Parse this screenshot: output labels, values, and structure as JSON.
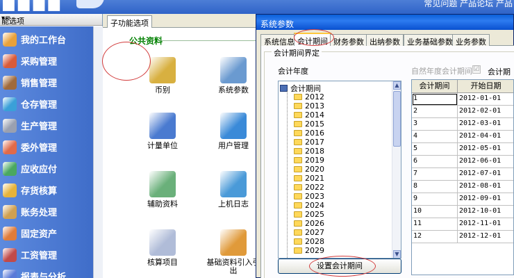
{
  "banner": {
    "logo": "■■■■",
    "links": "常见问题  产品论坛  产品"
  },
  "sidebar": {
    "header": "能选项",
    "pin": "▾≡",
    "items": [
      {
        "label": "我的工作台",
        "color": "#e8a13a"
      },
      {
        "label": "采购管理",
        "color": "#d85b3a"
      },
      {
        "label": "销售管理",
        "color": "#a06a3c"
      },
      {
        "label": "仓存管理",
        "color": "#3aa0d8"
      },
      {
        "label": "生产管理",
        "color": "#9aa0b0"
      },
      {
        "label": "委外管理",
        "color": "#e06a4a"
      },
      {
        "label": "应收应付",
        "color": "#4aa860"
      },
      {
        "label": "存货核算",
        "color": "#e8b33a"
      },
      {
        "label": "账务处理",
        "color": "#d0a050"
      },
      {
        "label": "固定资产",
        "color": "#e07c3a"
      },
      {
        "label": "工资管理",
        "color": "#c04a4a"
      },
      {
        "label": "报表与分析",
        "color": "#5a7ad8"
      }
    ]
  },
  "middle": {
    "tab": "子功能选项",
    "section_title": "公共资料",
    "functions": [
      {
        "label": "币别",
        "color": "#d8b040"
      },
      {
        "label": "系统参数",
        "color": "#6a9ad0"
      },
      {
        "label": "计量单位",
        "color": "#4a7ad0"
      },
      {
        "label": "用户管理",
        "color": "#3a8ad8"
      },
      {
        "label": "辅助资料",
        "color": "#6ab07a"
      },
      {
        "label": "上机日志",
        "color": "#4a9ad8"
      },
      {
        "label": "核算项目",
        "color": "#b0bcd8"
      },
      {
        "label": "基础资料引入引出",
        "color": "#e09a3a"
      }
    ]
  },
  "dialog": {
    "title": "系统参数",
    "tabs": [
      "系统信息",
      "会计期间",
      "财务参数",
      "出纳参数",
      "业务基础参数",
      "业务参数"
    ],
    "group_title": "会计期间界定",
    "year_label": "会计年度",
    "natural_year_label": "自然年度会计期间",
    "checkbox_mark": "☑",
    "period_label": "会计期",
    "tree_root": "会计期间",
    "years": [
      "2012",
      "2013",
      "2014",
      "2015",
      "2016",
      "2017",
      "2018",
      "2019",
      "2020",
      "2021",
      "2022",
      "2023",
      "2024",
      "2025",
      "2026",
      "2027",
      "2028",
      "2029"
    ],
    "scroll_up": "▲",
    "scroll_down": "▼",
    "set_button": "设置会计期间",
    "grid": {
      "columns": [
        "会计期间",
        "开始日期"
      ],
      "rows": [
        [
          "1",
          "2012-01-01"
        ],
        [
          "2",
          "2012-02-01"
        ],
        [
          "3",
          "2012-03-01"
        ],
        [
          "4",
          "2012-04-01"
        ],
        [
          "5",
          "2012-05-01"
        ],
        [
          "6",
          "2012-06-01"
        ],
        [
          "7",
          "2012-07-01"
        ],
        [
          "8",
          "2012-08-01"
        ],
        [
          "9",
          "2012-09-01"
        ],
        [
          "10",
          "2012-10-01"
        ],
        [
          "11",
          "2012-11-01"
        ],
        [
          "12",
          "2012-12-01"
        ]
      ]
    }
  }
}
